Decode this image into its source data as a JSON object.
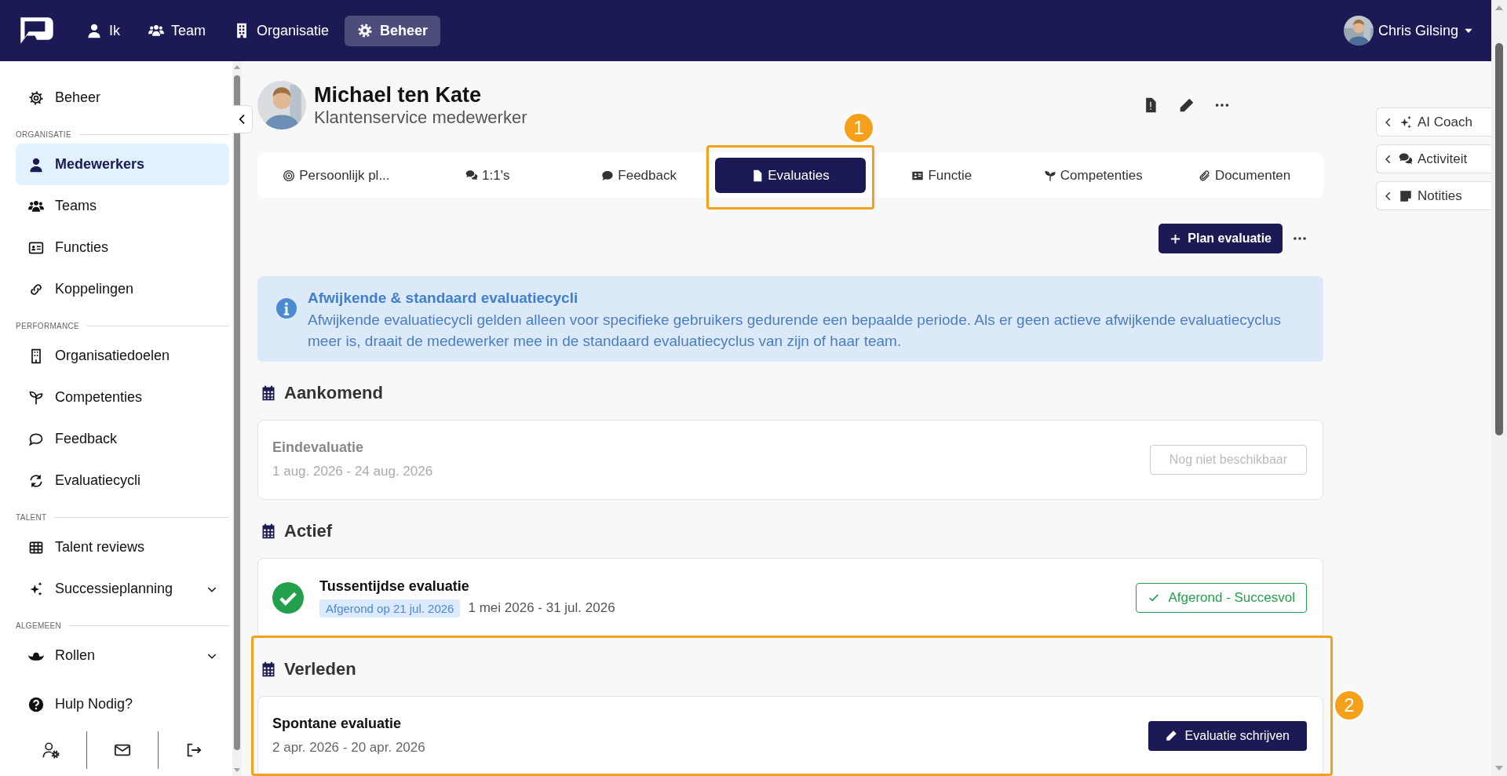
{
  "topbar": {
    "nav": [
      {
        "label": "Ik",
        "selected": false
      },
      {
        "label": "Team",
        "selected": false
      },
      {
        "label": "Organisatie",
        "selected": false
      },
      {
        "label": "Beheer",
        "selected": true
      }
    ],
    "user": {
      "name": "Chris Gilsing"
    }
  },
  "sidebar": {
    "top_item": {
      "label": "Beheer"
    },
    "sections": [
      {
        "title": "ORGANISATIE",
        "items": [
          {
            "label": "Medewerkers",
            "selected": true,
            "expandable": false
          },
          {
            "label": "Teams",
            "selected": false,
            "expandable": false
          },
          {
            "label": "Functies",
            "selected": false,
            "expandable": false
          },
          {
            "label": "Koppelingen",
            "selected": false,
            "expandable": false
          }
        ]
      },
      {
        "title": "PERFORMANCE",
        "items": [
          {
            "label": "Organisatiedoelen",
            "selected": false,
            "expandable": false
          },
          {
            "label": "Competenties",
            "selected": false,
            "expandable": false
          },
          {
            "label": "Feedback",
            "selected": false,
            "expandable": false
          },
          {
            "label": "Evaluatiecycli",
            "selected": false,
            "expandable": false
          }
        ]
      },
      {
        "title": "TALENT",
        "items": [
          {
            "label": "Talent reviews",
            "selected": false,
            "expandable": false
          },
          {
            "label": "Successieplanning",
            "selected": false,
            "expandable": true
          }
        ]
      },
      {
        "title": "ALGEMEEN",
        "items": [
          {
            "label": "Rollen",
            "selected": false,
            "expandable": true
          }
        ]
      }
    ],
    "help": {
      "label": "Hulp Nodig?"
    }
  },
  "profile": {
    "name": "Michael ten Kate",
    "role": "Klantenservice medewerker"
  },
  "tabs": [
    {
      "label": "Persoonlijk pl...",
      "selected": false
    },
    {
      "label": "1:1's",
      "selected": false
    },
    {
      "label": "Feedback",
      "selected": false
    },
    {
      "label": "Evaluaties",
      "selected": true
    },
    {
      "label": "Functie",
      "selected": false
    },
    {
      "label": "Competenties",
      "selected": false
    },
    {
      "label": "Documenten",
      "selected": false
    }
  ],
  "plan_button": {
    "label": "Plan evaluatie"
  },
  "info": {
    "title": "Afwijkende & standaard evaluatiecycli",
    "text": "Afwijkende evaluatiecycli gelden alleen voor specifieke gebruikers gedurende een bepaalde periode. Als er geen actieve afwijkende evaluatiecyclus meer is, draait de medewerker mee in de standaard evaluatiecyclus van zijn of haar team."
  },
  "sections": [
    {
      "title": "Aankomend",
      "items": [
        {
          "kind": "upcoming",
          "title": "Eindevaluatie",
          "dates": "1 aug. 2026 - 24 aug. 2026",
          "status": "Nog niet beschikbaar"
        }
      ]
    },
    {
      "title": "Actief",
      "items": [
        {
          "kind": "completed",
          "title": "Tussentijdse evaluatie",
          "badge": "Afgerond op 21 jul. 2026",
          "dates": "1 mei 2026 - 31 jul. 2026",
          "status": "Afgerond - Succesvol"
        }
      ]
    },
    {
      "title": "Verleden",
      "items": [
        {
          "kind": "write",
          "title": "Spontane evaluatie",
          "dates": "2 apr. 2026 - 20 apr. 2026",
          "status": "Evaluatie schrijven"
        }
      ]
    }
  ],
  "side_panels": [
    {
      "label": "AI Coach"
    },
    {
      "label": "Activiteit"
    },
    {
      "label": "Notities"
    }
  ],
  "annotations": [
    {
      "label": "1"
    },
    {
      "label": "2"
    }
  ]
}
